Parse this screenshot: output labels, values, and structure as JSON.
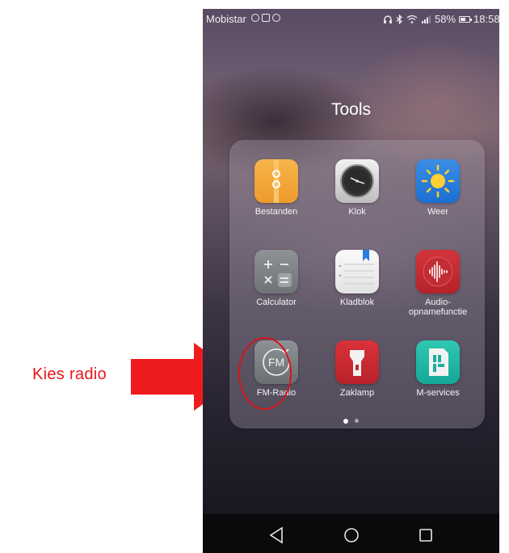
{
  "annotation": {
    "label": "Kies radio",
    "color": "#e8161b"
  },
  "statusbar": {
    "carrier": "Mobistar",
    "battery": "58%",
    "time": "18:58",
    "battery_level": 0.58
  },
  "folder": {
    "title": "Tools",
    "apps": [
      {
        "label": "Bestanden",
        "icon": "folder-icon"
      },
      {
        "label": "Klok",
        "icon": "clock-icon"
      },
      {
        "label": "Weer",
        "icon": "sun-icon"
      },
      {
        "label": "Calculator",
        "icon": "calculator-icon"
      },
      {
        "label": "Kladblok",
        "icon": "notepad-icon"
      },
      {
        "label": "Audio-",
        "label2": "opnamefunctie",
        "icon": "audio-wave-icon"
      },
      {
        "label": "FM-Radio",
        "icon": "fm-radio-icon",
        "icon_text": "FM"
      },
      {
        "label": "Zaklamp",
        "icon": "flashlight-icon"
      },
      {
        "label": "M-services",
        "icon": "sim-card-icon"
      }
    ],
    "pages": 2,
    "current_page": 1
  },
  "navbar": {
    "back": "back-icon",
    "home": "home-icon",
    "recents": "recents-icon"
  }
}
